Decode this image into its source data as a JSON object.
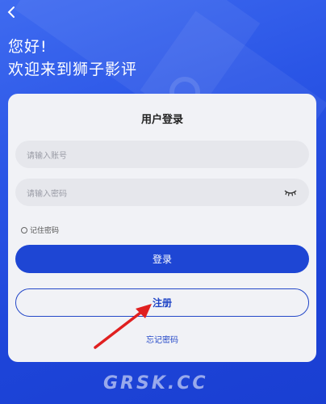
{
  "header": {
    "back_icon": "chevron-left-icon",
    "greeting_line1": "您好!",
    "greeting_line2": "欢迎来到狮子影评"
  },
  "login_card": {
    "title": "用户登录",
    "account_placeholder": "请输入账号",
    "password_placeholder": "请输入密码",
    "password_toggle_icon": "eye-closed-icon",
    "remember_label": "记住密码",
    "login_label": "登录",
    "register_label": "注册",
    "forgot_label": "忘记密码"
  },
  "watermark": "GRSK.CC",
  "colors": {
    "background": "#2a55e6",
    "primary_button": "#1e46d4",
    "card": "#f1f2f6",
    "annotation_arrow": "#e02020"
  }
}
